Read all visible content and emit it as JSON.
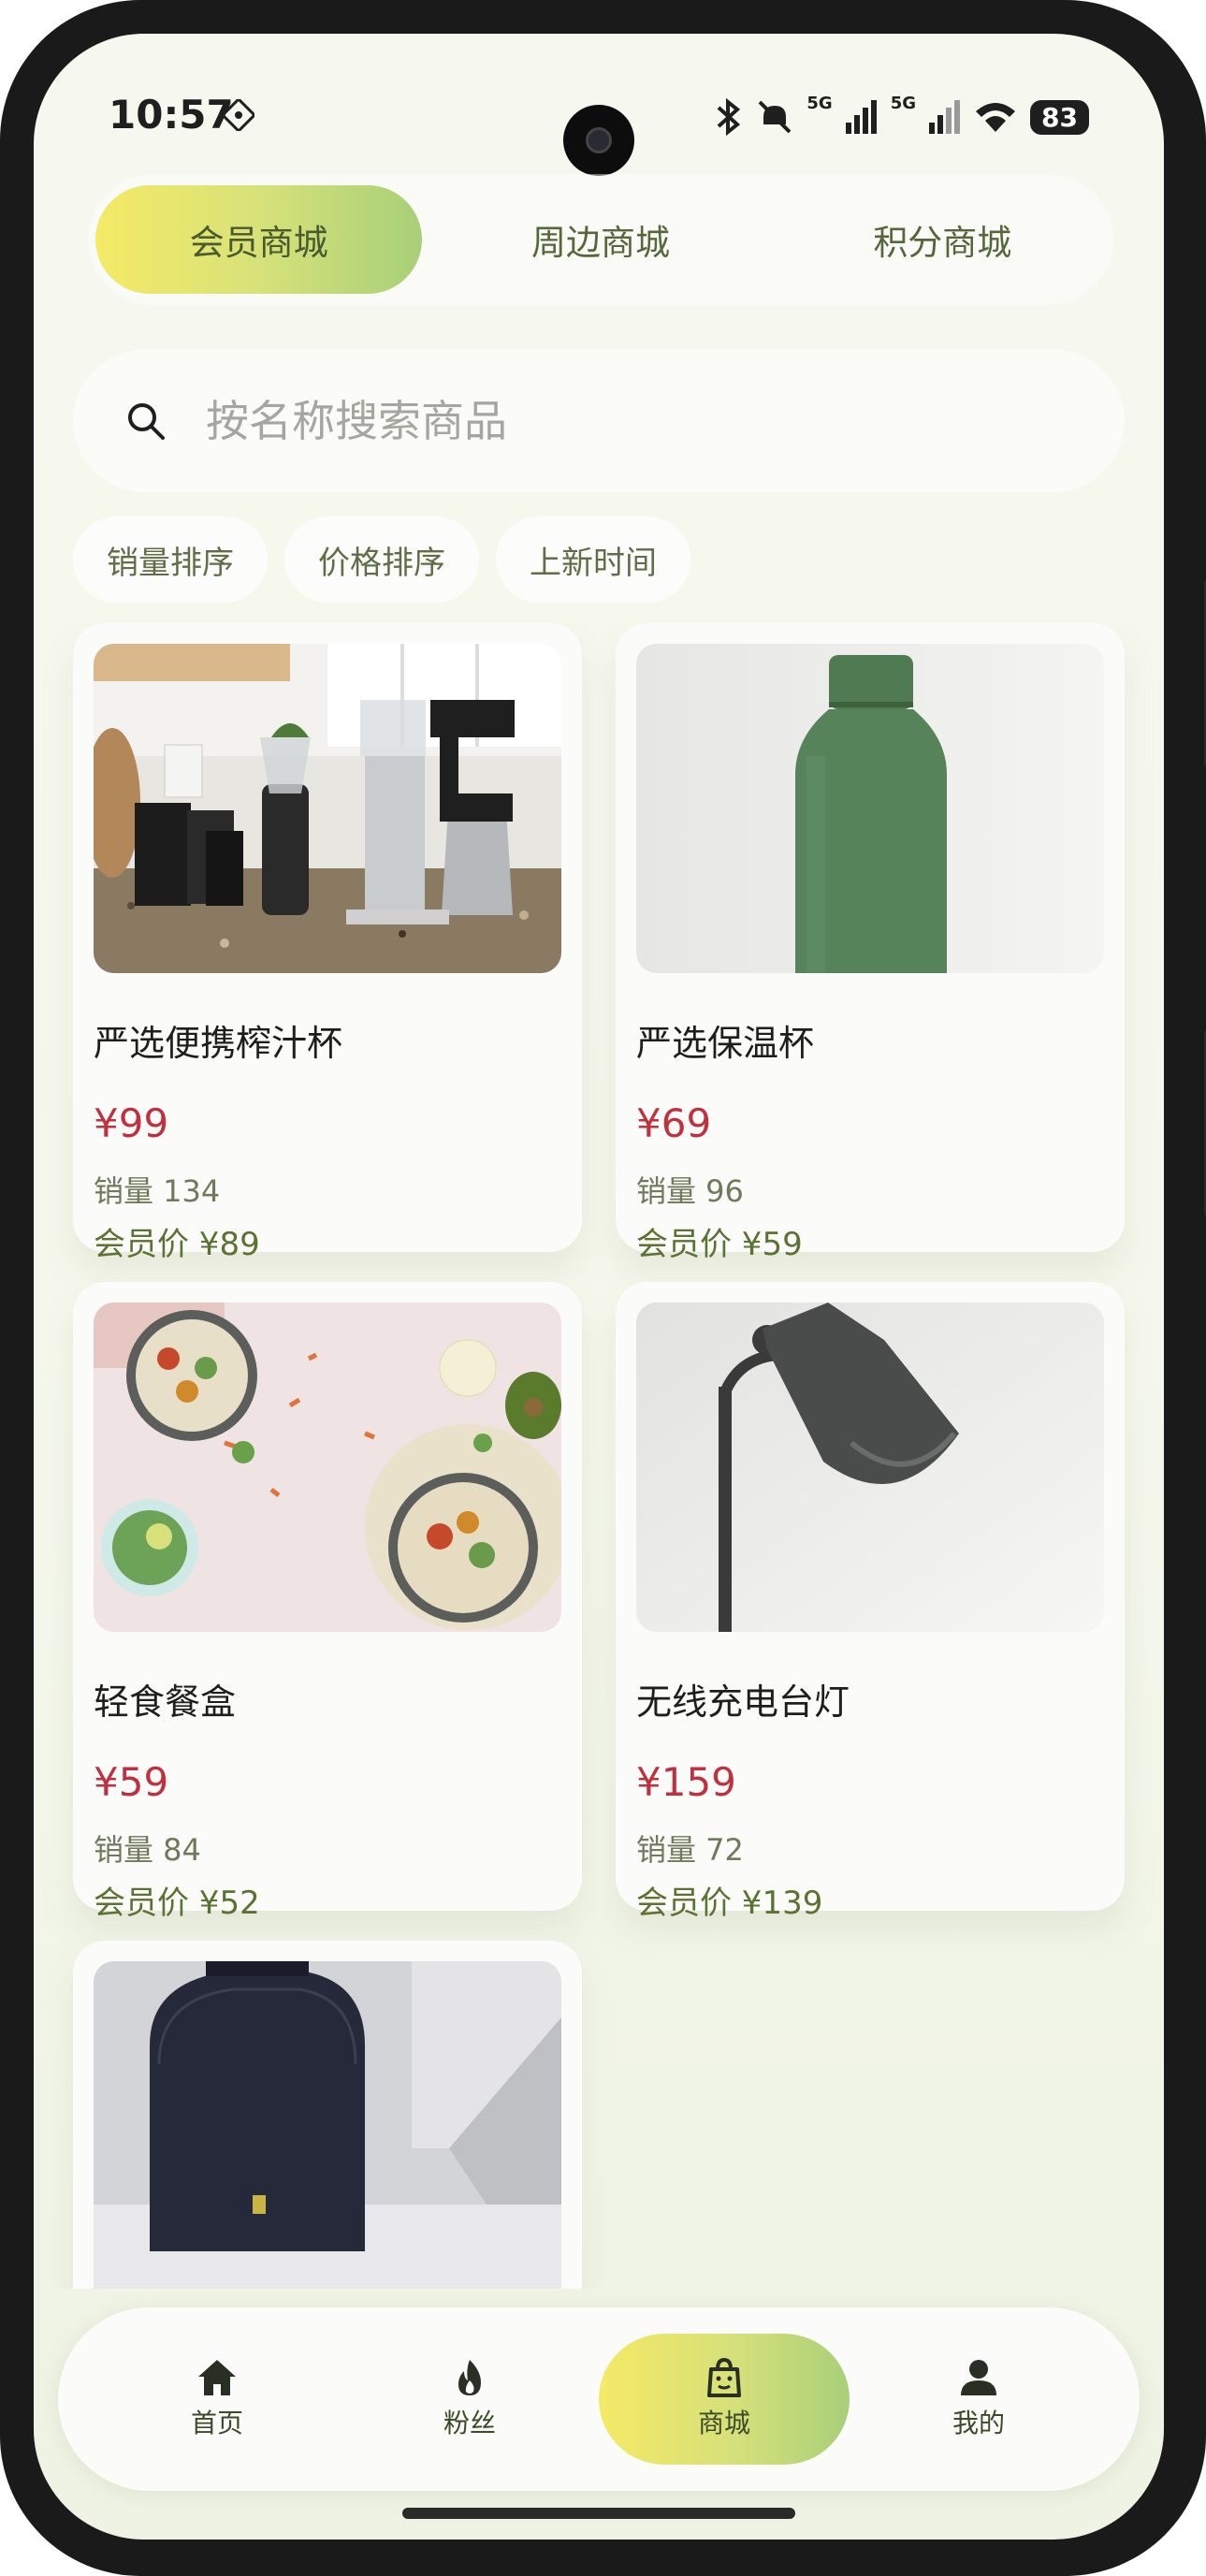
{
  "status_bar": {
    "time": "10:57",
    "network_1": "5G",
    "network_2": "5G",
    "battery": "83"
  },
  "tabs": [
    {
      "label": "会员商城",
      "active": true
    },
    {
      "label": "周边商城",
      "active": false
    },
    {
      "label": "积分商城",
      "active": false
    }
  ],
  "search": {
    "placeholder": "按名称搜索商品",
    "value": ""
  },
  "sort_chips": [
    "销量排序",
    "价格排序",
    "上新时间"
  ],
  "products": [
    {
      "name": "严选便携榨汁杯",
      "price": "¥99",
      "sales": "销量 134",
      "member_price": "会员价 ¥89"
    },
    {
      "name": "严选保温杯",
      "price": "¥69",
      "sales": "销量 96",
      "member_price": "会员价 ¥59"
    },
    {
      "name": "轻食餐盒",
      "price": "¥59",
      "sales": "销量 84",
      "member_price": "会员价 ¥52"
    },
    {
      "name": "无线充电台灯",
      "price": "¥159",
      "sales": "销量 72",
      "member_price": "会员价 ¥139"
    },
    {
      "name": "",
      "price": "",
      "sales": "",
      "member_price": ""
    }
  ],
  "bottom_nav": [
    {
      "label": "首页",
      "icon": "home-icon",
      "active": false
    },
    {
      "label": "粉丝",
      "icon": "flame-icon",
      "active": false
    },
    {
      "label": "商城",
      "icon": "shopping-bag-icon",
      "active": true
    },
    {
      "label": "我的",
      "icon": "person-icon",
      "active": false
    }
  ],
  "colors": {
    "accent_start": "#f4ea66",
    "accent_end": "#a8cf79",
    "price": "#c0303e",
    "member_price": "#5b7332"
  }
}
